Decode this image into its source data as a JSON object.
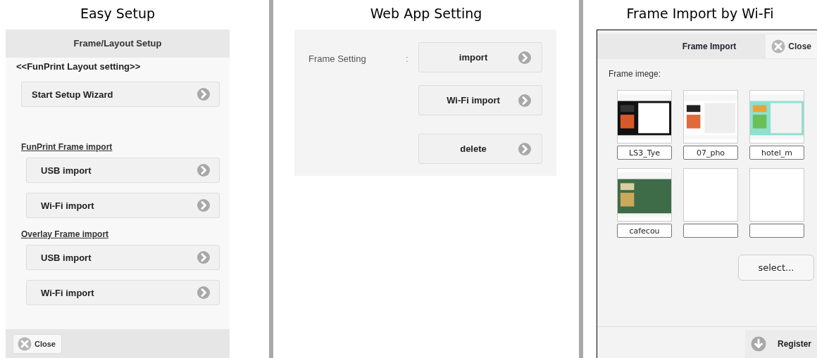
{
  "easy_setup": {
    "caption": "Easy Setup",
    "header": "Frame/Layout Setup",
    "subtitle": "<<FunPrint Layout setting>>",
    "sections": [
      {
        "buttons": [
          "Start Setup Wizard"
        ]
      },
      {
        "heading": "FunPrint Frame import",
        "buttons": [
          "USB import",
          "Wi-Fi import"
        ]
      },
      {
        "heading": "Overlay Frame import",
        "buttons": [
          "USB import",
          "Wi-Fi import"
        ]
      }
    ],
    "close": "Close"
  },
  "web_app_setting": {
    "caption": "Web App Setting",
    "label": "Frame Setting",
    "separator": ":",
    "buttons": [
      "import",
      "Wi-Fi import",
      "delete"
    ]
  },
  "frame_import": {
    "caption": "Frame Import by Wi-Fi",
    "header": "Frame Import",
    "close": "Close",
    "label": "Frame imege:",
    "frames": [
      {
        "kind": "picture",
        "name": "LS3_Tye"
      },
      {
        "kind": "picture",
        "name": "07_pho"
      },
      {
        "kind": "picture",
        "name": "hotel_m"
      },
      {
        "kind": "picture",
        "name": "cafecou"
      },
      {
        "kind": "empty"
      },
      {
        "kind": "empty"
      }
    ],
    "select": "select...",
    "register": "Register"
  }
}
